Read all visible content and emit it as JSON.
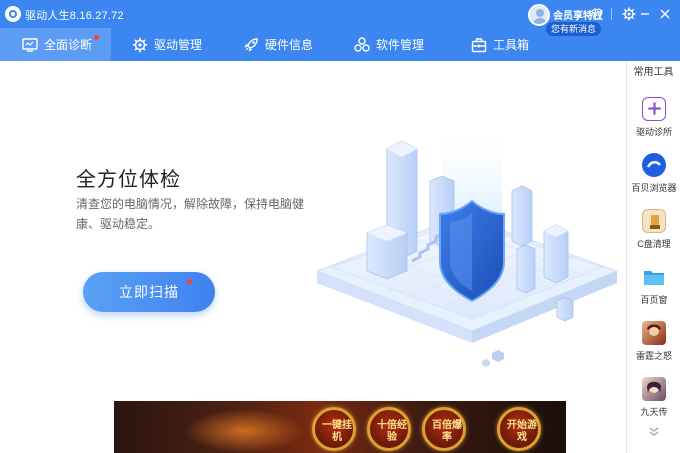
{
  "app": {
    "title": "驱动人生8.16.27.72",
    "vip_label": "会员享特权",
    "message_badge": "您有新消息"
  },
  "nav": {
    "tabs": [
      {
        "label": "全面诊断",
        "active": true
      },
      {
        "label": "驱动管理",
        "active": false
      },
      {
        "label": "硬件信息",
        "active": false
      },
      {
        "label": "软件管理",
        "active": false
      },
      {
        "label": "工具箱",
        "active": false
      }
    ]
  },
  "main": {
    "headline": "全方位体检",
    "description": "清查您的电脑情况，解除故障，保持电脑健康、驱动稳定。",
    "scan_button": "立即扫描"
  },
  "sidebar": {
    "header": "常用工具",
    "tools": [
      {
        "label": "驱动诊所",
        "icon": "diagnosis-icon"
      },
      {
        "label": "百贝浏览器",
        "icon": "browser-icon"
      },
      {
        "label": "C盘清理",
        "icon": "disk-clean-icon"
      },
      {
        "label": "百页窗",
        "icon": "folder-icon"
      },
      {
        "label": "雷霆之怒",
        "icon": "game-avatar-icon"
      },
      {
        "label": "九天传",
        "icon": "game-avatar-icon"
      }
    ]
  },
  "ad": {
    "medals": [
      "一键挂机",
      "十倍经验",
      "百倍爆率",
      "开始游戏"
    ]
  },
  "colors": {
    "primary": "#3b86f0",
    "active_tab": "#5d9cf4",
    "notice_dot": "#ff3b30"
  }
}
